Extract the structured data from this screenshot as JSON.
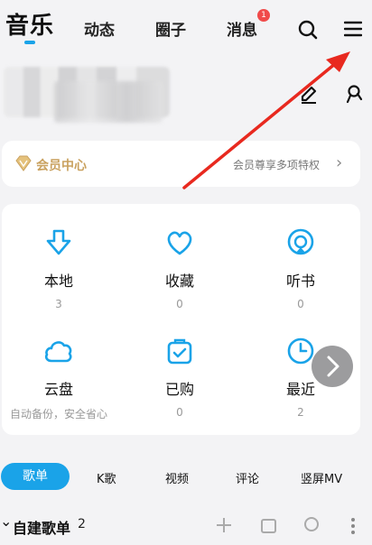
{
  "nav": {
    "active_tab": "音乐",
    "tabs": [
      "动态",
      "圈子",
      "消息"
    ],
    "message_badge": "1",
    "search_icon": "search-icon",
    "menu_icon": "menu-icon"
  },
  "vip": {
    "label": "会员中心",
    "promo": "会员尊享多项特权",
    "chevron": "›"
  },
  "grid": [
    {
      "label": "本地",
      "count": "3",
      "icon": "download-icon"
    },
    {
      "label": "收藏",
      "count": "0",
      "icon": "heart-icon"
    },
    {
      "label": "听书",
      "count": "0",
      "icon": "headphone-icon"
    },
    {
      "label": "云盘",
      "count": "自动备份，安全省心",
      "icon": "cloud-icon"
    },
    {
      "label": "已购",
      "count": "0",
      "icon": "bag-icon"
    },
    {
      "label": "最近",
      "count": "2",
      "icon": "clock-icon"
    }
  ],
  "categories": {
    "active": "歌单",
    "tabs": [
      "K歌",
      "视频",
      "评论",
      "竖屏MV"
    ]
  },
  "playlist_section": {
    "title": "自建歌单",
    "count": "2",
    "chevron": "⌄"
  },
  "colors": {
    "accent": "#1aa3e8",
    "vip_gold": "#c9a15f",
    "badge_red": "#f04a4a",
    "annotation_arrow": "#e8291f"
  }
}
